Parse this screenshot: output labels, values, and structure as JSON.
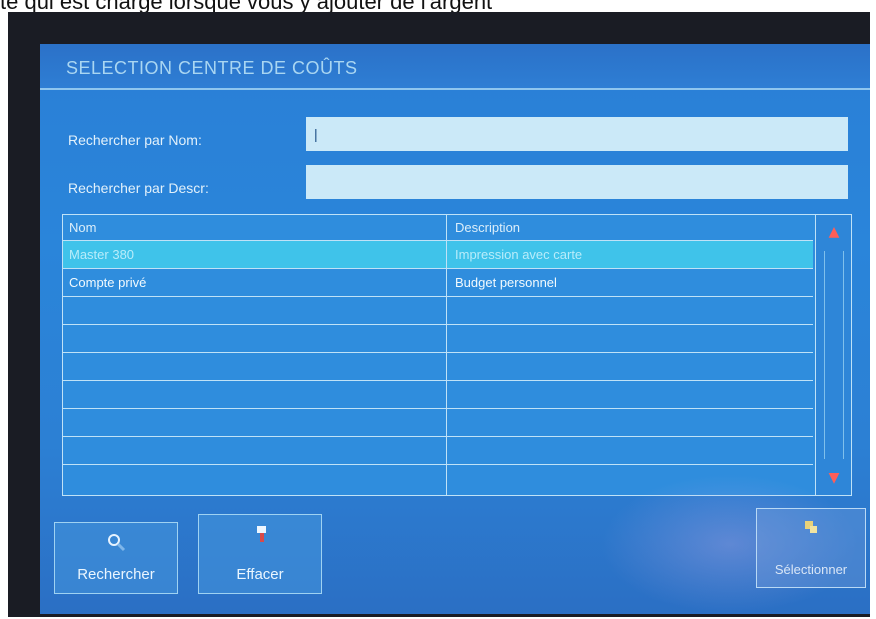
{
  "caption": "te qui est chargé lorsque vous y ajouter de l'argent",
  "dialog": {
    "title": "SELECTION CENTRE DE COÛTS"
  },
  "search": {
    "name_label": "Rechercher par Nom:",
    "name_value": "|",
    "descr_label": "Rechercher par Descr:",
    "descr_value": ""
  },
  "table": {
    "columns": [
      "Nom",
      "Description"
    ],
    "rows": [
      {
        "nom": "Master 380",
        "description": "Impression avec carte",
        "selected": true
      },
      {
        "nom": "Compte privé",
        "description": "Budget personnel",
        "selected": false
      },
      {
        "nom": "",
        "description": "",
        "selected": false
      },
      {
        "nom": "",
        "description": "",
        "selected": false
      },
      {
        "nom": "",
        "description": "",
        "selected": false
      },
      {
        "nom": "",
        "description": "",
        "selected": false
      },
      {
        "nom": "",
        "description": "",
        "selected": false
      },
      {
        "nom": "",
        "description": "",
        "selected": false
      }
    ]
  },
  "buttons": {
    "search_label": "Rechercher",
    "search_icon": "magnifier-icon",
    "clear_label": "Effacer",
    "clear_icon": "eraser-icon",
    "select_label": "Sélectionner",
    "select_icon": "select-icon"
  },
  "colors": {
    "screen_blue": "#2a85da",
    "selected_row": "#3fc3ea",
    "scroll_arrow": "#ff5e58"
  }
}
